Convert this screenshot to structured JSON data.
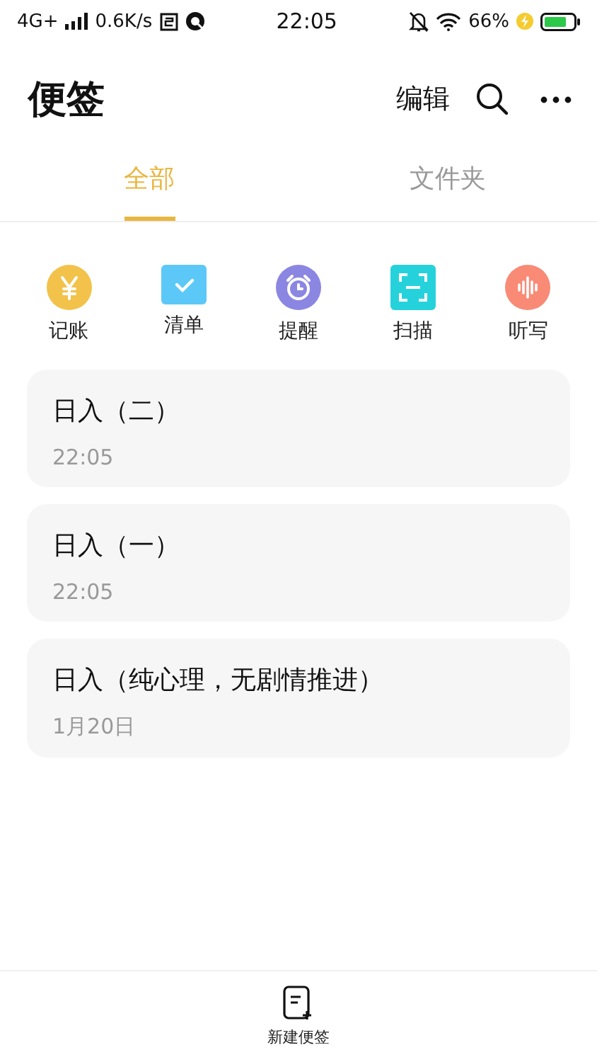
{
  "status_bar": {
    "network": "4G+",
    "speed": "0.6K/s",
    "time": "22:05",
    "battery": "66%"
  },
  "header": {
    "title": "便签",
    "edit": "编辑"
  },
  "tabs": [
    {
      "label": "全部",
      "selected": true
    },
    {
      "label": "文件夹",
      "selected": false
    }
  ],
  "quick_actions": [
    {
      "kind": "ledger",
      "label": "记账"
    },
    {
      "kind": "checklist",
      "label": "清单"
    },
    {
      "kind": "reminder",
      "label": "提醒"
    },
    {
      "kind": "scan",
      "label": "扫描"
    },
    {
      "kind": "dictation",
      "label": "听写"
    }
  ],
  "notes": [
    {
      "title": "日入（二）",
      "time": "22:05"
    },
    {
      "title": "日入（一）",
      "time": "22:05"
    },
    {
      "title": "日入（纯心理，无剧情推进）",
      "time": "1月20日"
    }
  ],
  "bottom_bar": {
    "label": "新建便签"
  }
}
